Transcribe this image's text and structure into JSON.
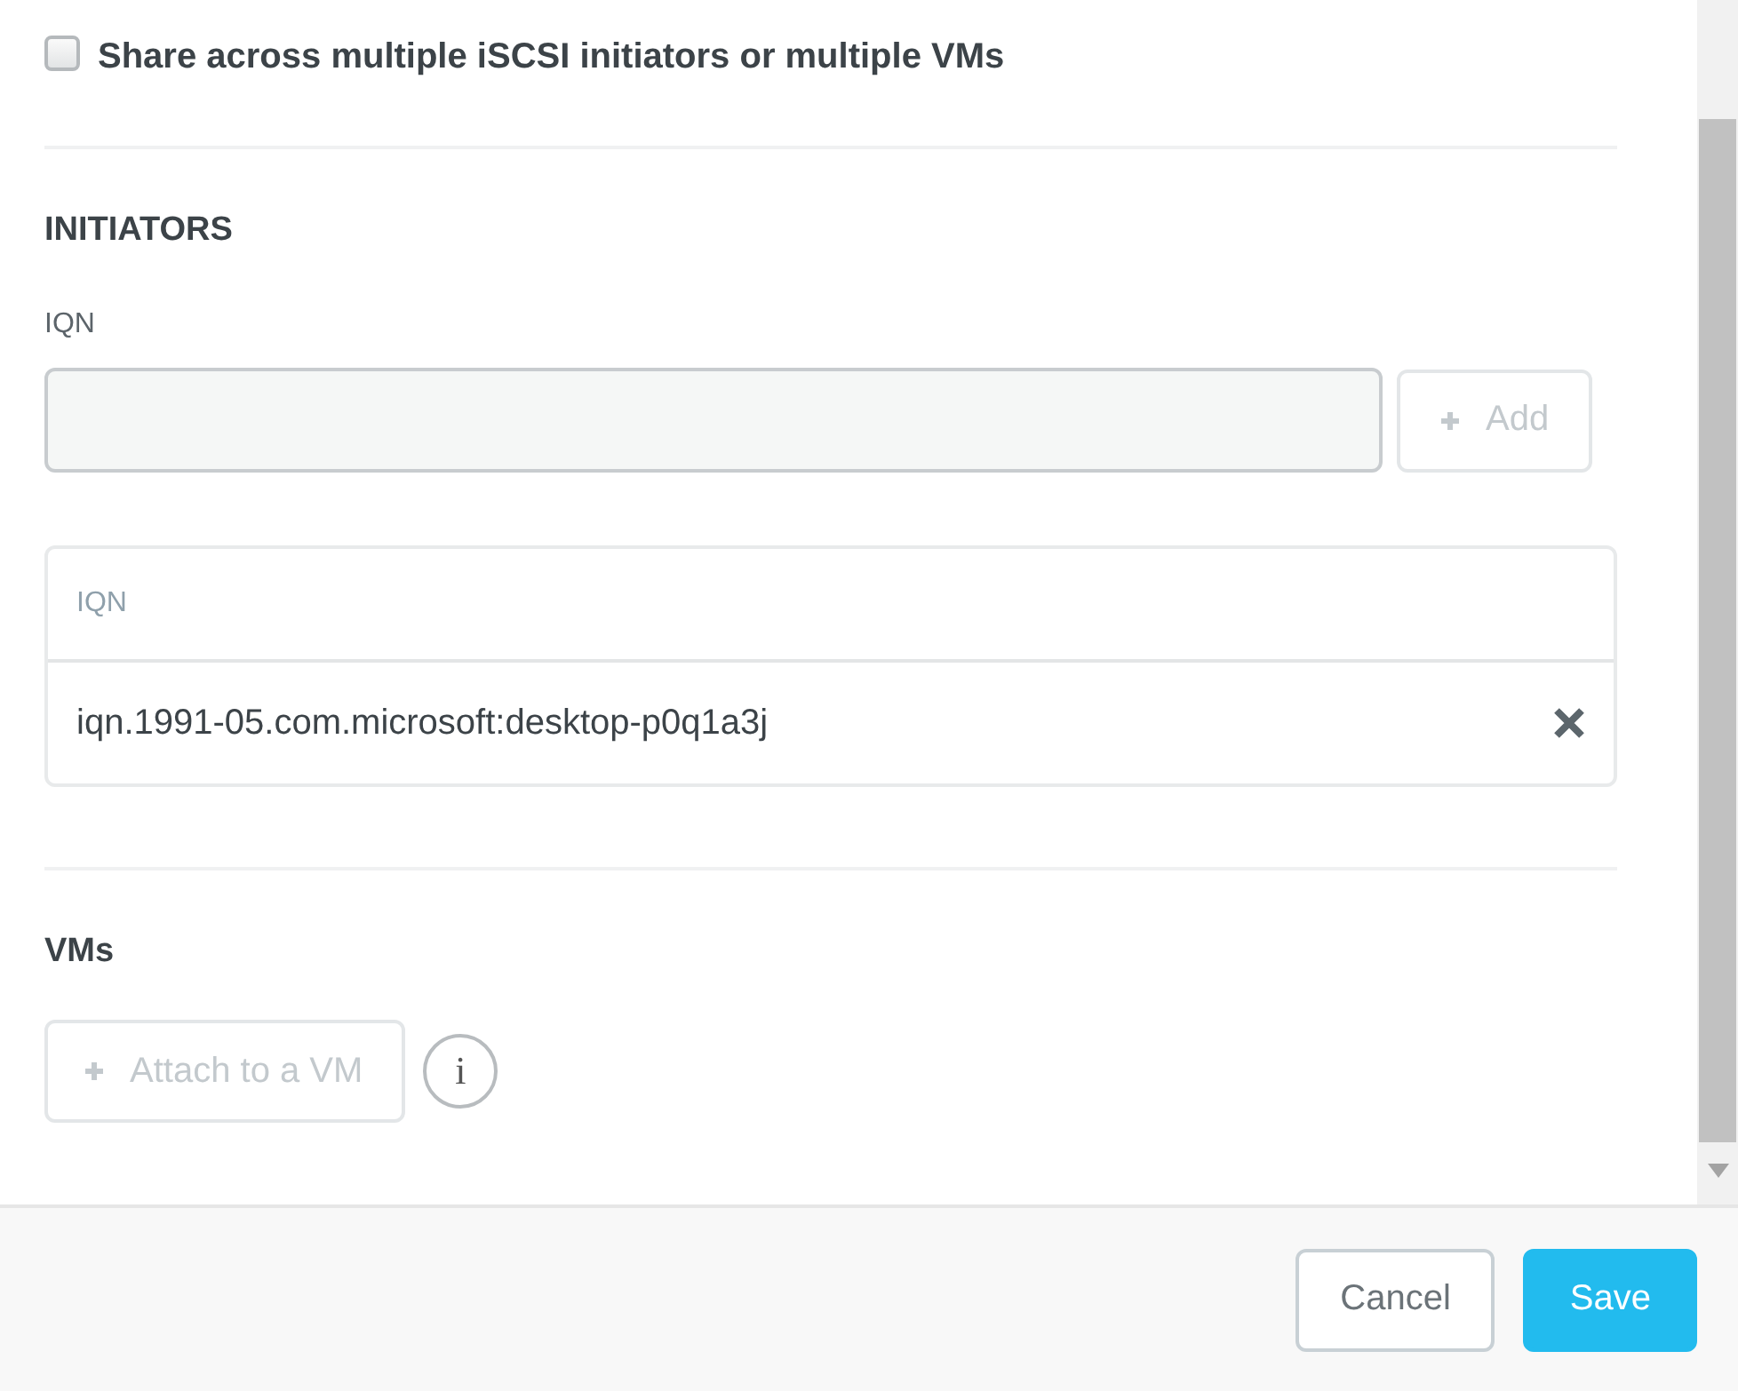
{
  "share_checkbox": {
    "label": "Share across multiple iSCSI initiators or multiple VMs",
    "checked": false
  },
  "initiators": {
    "heading": "INITIATORS",
    "field_label": "IQN",
    "add_button": {
      "label": "Add",
      "disabled": true
    },
    "table": {
      "columns": [
        "IQN"
      ],
      "rows": [
        {
          "iqn": "iqn.1991-05.com.microsoft:desktop-p0q1a3j"
        }
      ]
    }
  },
  "vms": {
    "heading": "VMs",
    "attach_button": {
      "label": "Attach to a VM",
      "disabled": true
    },
    "info": "i"
  },
  "footer": {
    "buttons": [
      {
        "label": "Cancel",
        "kind": "secondary"
      },
      {
        "label": "Save",
        "kind": "primary"
      }
    ]
  }
}
